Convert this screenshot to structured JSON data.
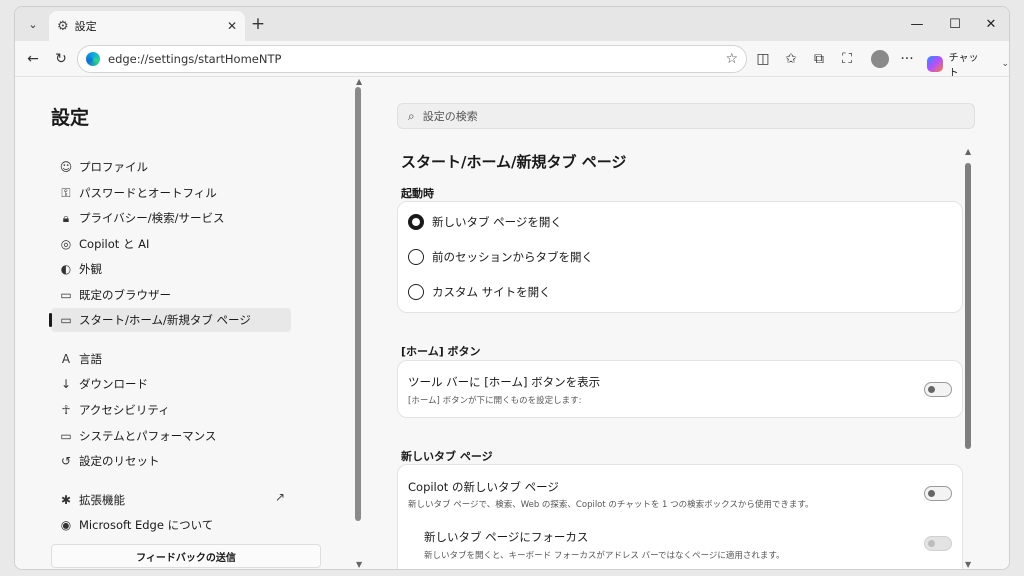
{
  "tab": {
    "title": "設定"
  },
  "address": {
    "url": "edge://settings/startHomeNTP"
  },
  "toolbar": {
    "copilot_label": "チャット"
  },
  "sidebar": {
    "title": "設定",
    "items": [
      {
        "label": "プロファイル",
        "icon": "profile-icon"
      },
      {
        "label": "パスワードとオートフィル",
        "icon": "key-icon"
      },
      {
        "label": "プライバシー/検索/サービス",
        "icon": "lock-icon"
      },
      {
        "label": "Copilot と AI",
        "icon": "copilot-icon"
      },
      {
        "label": "外観",
        "icon": "palette-icon"
      },
      {
        "label": "既定のブラウザー",
        "icon": "browser-icon"
      },
      {
        "label": "スタート/ホーム/新規タブ ページ",
        "icon": "home-tab-icon"
      },
      {
        "label": "言語",
        "icon": "language-icon"
      },
      {
        "label": "ダウンロード",
        "icon": "download-icon"
      },
      {
        "label": "アクセシビリティ",
        "icon": "accessibility-icon"
      },
      {
        "label": "システムとパフォーマンス",
        "icon": "laptop-icon"
      },
      {
        "label": "設定のリセット",
        "icon": "reset-icon"
      },
      {
        "label": "拡張機能",
        "icon": "extensions-icon"
      },
      {
        "label": "Microsoft Edge について",
        "icon": "edge-icon"
      }
    ],
    "feedback": "フィードバックの送信"
  },
  "main": {
    "search_placeholder": "設定の検索",
    "title": "スタート/ホーム/新規タブ ページ",
    "startup": {
      "label": "起動時",
      "options": [
        "新しいタブ ページを開く",
        "前のセッションからタブを開く",
        "カスタム サイトを開く"
      ],
      "selected": 0
    },
    "home": {
      "label": "[ホーム] ボタン",
      "title": "ツール バーに [ホーム] ボタンを表示",
      "sub": "[ホーム] ボタンが下に開くものを設定します:",
      "enabled": false
    },
    "newtab": {
      "label": "新しいタブ ページ",
      "copilot_title": "Copilot の新しいタブ ページ",
      "copilot_sub": "新しいタブ ページで、検索、Web の探索、Copilot のチャットを 1 つの検索ボックスから使用できます。",
      "focus_title": "新しいタブ ページにフォーカス",
      "focus_sub": "新しいタブを開くと、キーボード フォーカスがアドレス バーではなくページに適用されます。"
    }
  }
}
